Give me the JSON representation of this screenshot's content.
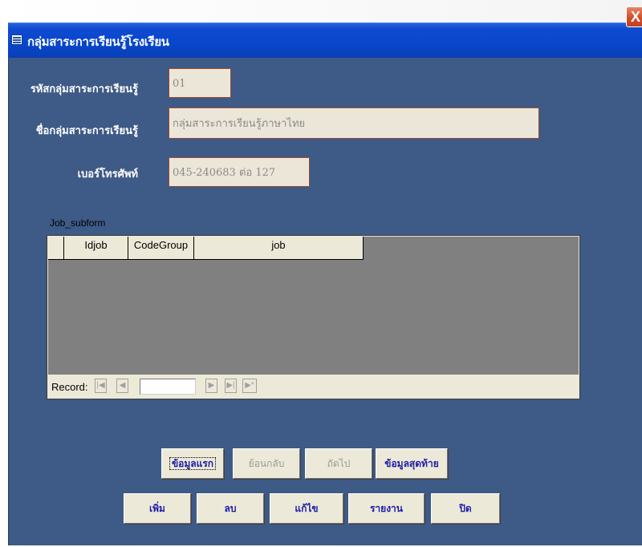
{
  "window": {
    "title": "กลุ่มสาระการเรียนรู้โรงเรียน",
    "close_glyph": "X",
    "colors": {
      "form_bg": "#3e5a86",
      "field_bg": "#ece6d9",
      "field_border": "#9a4a30",
      "button_text": "#1c1ca8"
    }
  },
  "form": {
    "code_label": "รหัสกลุ่มสาระการเรียนรู้",
    "code_value": "01",
    "name_label": "ชื่อกลุ่มสาระการเรียนรู้",
    "name_value": "กลุ่มสาระการเรียนรู้ภาษาไทย",
    "phone_label": "เบอร์โทรศัพท์",
    "phone_value": "045-240683 ต่อ 127"
  },
  "subform": {
    "label": "Job_subform",
    "columns": [
      "Idjob",
      "CodeGroup",
      "job"
    ],
    "rows": [],
    "record_label": "Record:",
    "record_value": "",
    "nav": {
      "first": "|◀",
      "prev": "◀",
      "next": "▶",
      "last": "▶|",
      "new": "▶*"
    }
  },
  "nav_buttons": {
    "first": "ข้อมูลแรก",
    "previous": "ย้อนกลับ",
    "next": "ถัดไป",
    "last": "ข้อมูลสุดท้าย"
  },
  "action_buttons": {
    "add": "เพิ่ม",
    "delete": "ลบ",
    "edit": "แก้ไข",
    "report": "รายงาน",
    "close": "ปิด"
  }
}
